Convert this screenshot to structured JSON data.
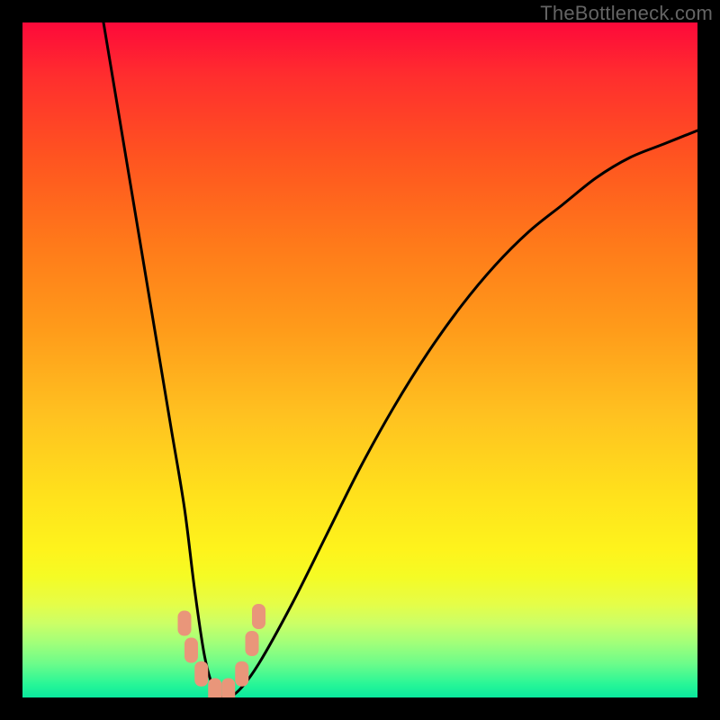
{
  "watermark": "TheBottleneck.com",
  "chart_data": {
    "type": "line",
    "title": "",
    "xlabel": "",
    "ylabel": "",
    "xlim": [
      0,
      100
    ],
    "ylim": [
      0,
      100
    ],
    "grid": false,
    "series": [
      {
        "name": "bottleneck-curve",
        "x": [
          12,
          14,
          16,
          18,
          20,
          22,
          24,
          25.5,
          27,
          28.5,
          30,
          32,
          35,
          40,
          45,
          50,
          55,
          60,
          65,
          70,
          75,
          80,
          85,
          90,
          95,
          100
        ],
        "values": [
          100,
          88,
          76,
          64,
          52,
          40,
          28,
          16,
          6,
          1,
          0,
          1,
          5,
          14,
          24,
          34,
          43,
          51,
          58,
          64,
          69,
          73,
          77,
          80,
          82,
          84
        ]
      }
    ],
    "markers": [
      {
        "x": 24.0,
        "y": 11.0
      },
      {
        "x": 25.0,
        "y": 7.0
      },
      {
        "x": 26.5,
        "y": 3.5
      },
      {
        "x": 28.5,
        "y": 1.0
      },
      {
        "x": 30.5,
        "y": 1.0
      },
      {
        "x": 32.5,
        "y": 3.5
      },
      {
        "x": 34.0,
        "y": 8.0
      },
      {
        "x": 35.0,
        "y": 12.0
      }
    ],
    "marker_color": "#e9967a",
    "curve_color": "#000000",
    "gradient_stops": [
      {
        "pos": 0,
        "color": "#fe093a"
      },
      {
        "pos": 20,
        "color": "#ff5420"
      },
      {
        "pos": 45,
        "color": "#ff9a1a"
      },
      {
        "pos": 70,
        "color": "#ffe11c"
      },
      {
        "pos": 85,
        "color": "#e6fd46"
      },
      {
        "pos": 100,
        "color": "#0ae89d"
      }
    ]
  }
}
